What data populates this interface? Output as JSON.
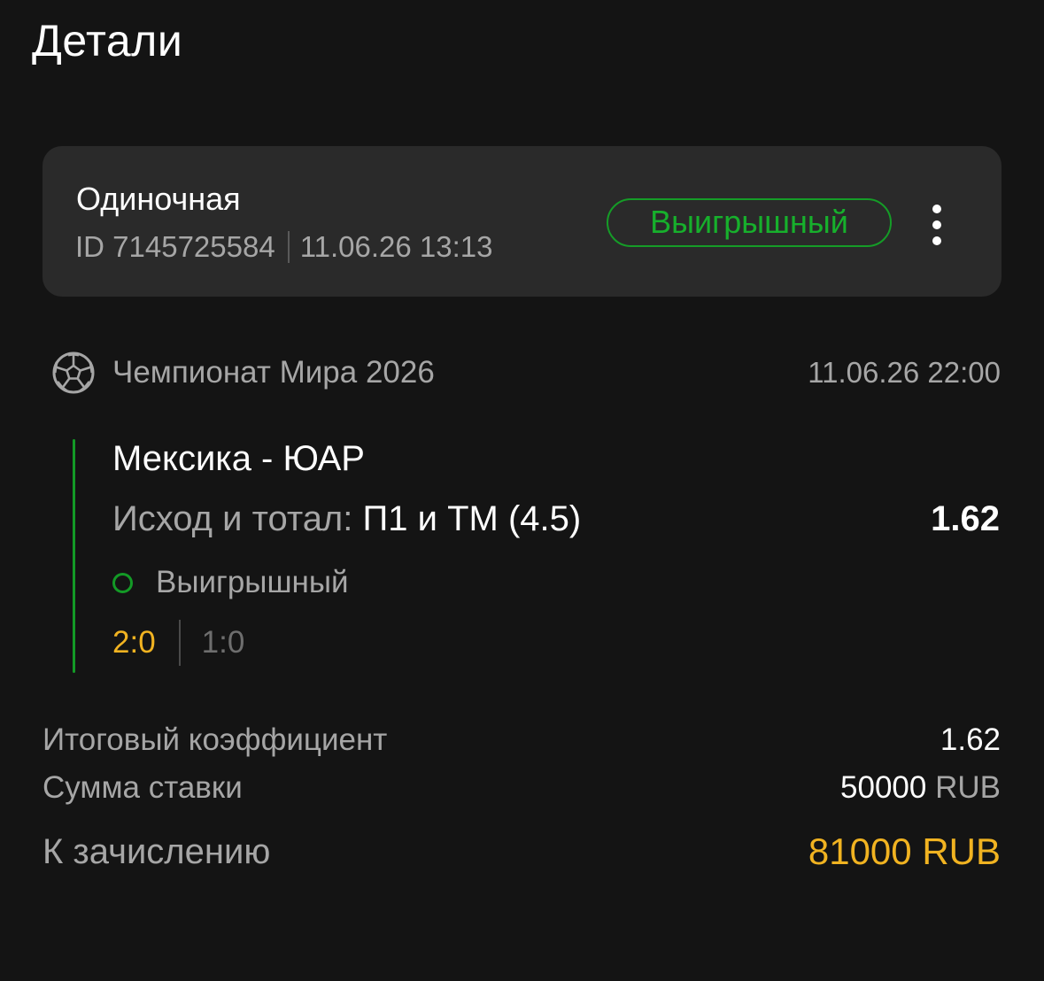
{
  "header": {
    "title": "Детали"
  },
  "bet_card": {
    "type": "Одиночная",
    "id_text": "ID 7145725584",
    "datetime": "11.06.26 13:13",
    "status": "Выигрышный",
    "status_color": "#17b02c"
  },
  "event": {
    "sport_icon": "soccer-ball-icon",
    "tournament": "Чемпионат Мира 2026",
    "date": "11.06.26 22:00",
    "match": "Мексика - ЮАР",
    "market_name": "Исход и тотал:",
    "market_pick": "П1 и ТМ (4.5)",
    "odds": "1.62",
    "result_status": "Выигрышный",
    "score_final": "2:0",
    "score_half": "1:0"
  },
  "summary": {
    "total_odds_label": "Итоговый коэффициент",
    "total_odds_value": "1.62",
    "stake_label": "Сумма ставки",
    "stake_amount": "50000",
    "stake_currency": "RUB",
    "payout_label": "К зачислению",
    "payout_value": "81000 RUB"
  },
  "colors": {
    "background": "#141414",
    "card": "#2a2a2a",
    "win_green": "#17b02c",
    "accent_gold": "#f1b321",
    "muted_text": "#a6a6a6"
  }
}
